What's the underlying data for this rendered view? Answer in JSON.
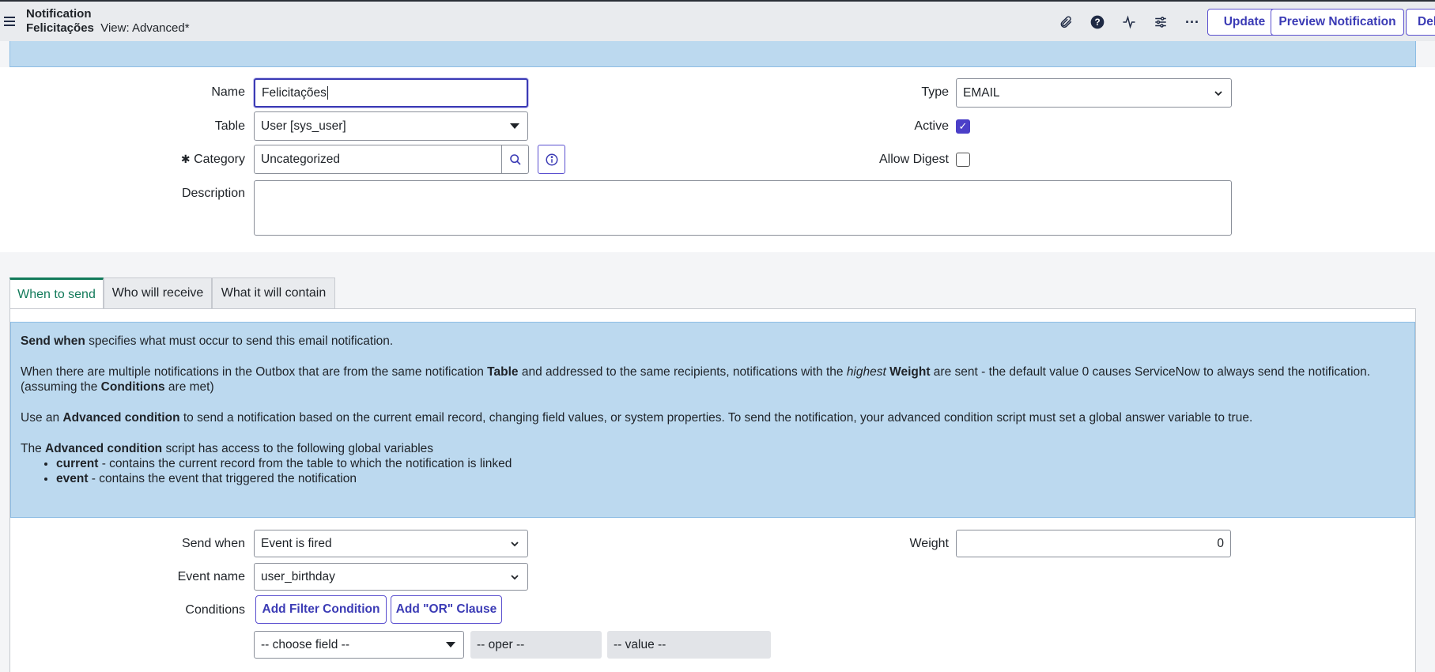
{
  "header": {
    "title": "Notification",
    "record_name": "Felicitações",
    "view_label": "View: Advanced*",
    "icons": [
      "paperclip-icon",
      "help-icon",
      "activity-icon",
      "settings-sliders-icon",
      "more-icon"
    ],
    "buttons": {
      "update": "Update",
      "preview": "Preview Notification",
      "delete": "Del"
    }
  },
  "form": {
    "name": {
      "label": "Name",
      "value": "Felicitações"
    },
    "table": {
      "label": "Table",
      "value": "User [sys_user]"
    },
    "category": {
      "label": "Category",
      "value": "Uncategorized",
      "required_mark": "✱"
    },
    "description": {
      "label": "Description",
      "value": ""
    },
    "type": {
      "label": "Type",
      "value": "EMAIL"
    },
    "active": {
      "label": "Active",
      "checked": true
    },
    "allow_digest": {
      "label": "Allow Digest",
      "checked": false
    }
  },
  "tabs": [
    {
      "label": "When to send",
      "active": true
    },
    {
      "label": "Who will receive",
      "active": false
    },
    {
      "label": "What it will contain",
      "active": false
    }
  ],
  "info": {
    "p1_b": "Send when",
    "p1": " specifies what must occur to send this email notification.",
    "p2_a": "When there are multiple notifications in the Outbox that are from the same notification ",
    "p2_b1": "Table",
    "p2_c": " and addressed to the same recipients, notifications with the ",
    "p2_i": "highest",
    "p2_d": " ",
    "p2_b2": "Weight",
    "p2_e": " are sent - the default value 0 causes ServiceNow to always send the notification. (assuming the ",
    "p2_b3": "Conditions",
    "p2_f": " are met)",
    "p3_a": "Use an ",
    "p3_b": "Advanced condition",
    "p3_c": " to send a notification based on the current email record, changing field values, or system properties. To send the notification, your advanced condition script must set a global answer variable to true.",
    "p4_a": "The ",
    "p4_b": "Advanced condition",
    "p4_c": " script has access to the following global variables",
    "li1_b": "current",
    "li1": " - contains the current record from the table to which the notification is linked",
    "li2_b": "event",
    "li2": " - contains the event that triggered the notification"
  },
  "send": {
    "send_when": {
      "label": "Send when",
      "value": "Event is fired"
    },
    "event_name": {
      "label": "Event name",
      "value": "user_birthday"
    },
    "weight": {
      "label": "Weight",
      "value": "0"
    },
    "conditions": {
      "label": "Conditions",
      "add_filter": "Add Filter Condition",
      "add_or": "Add \"OR\" Clause"
    },
    "filter": {
      "field": "-- choose field --",
      "oper": "-- oper --",
      "value": "-- value --"
    }
  },
  "colors": {
    "accent": "#3b3bb5",
    "banner": "#bcd9ef",
    "active_tab": "#127a5a"
  }
}
